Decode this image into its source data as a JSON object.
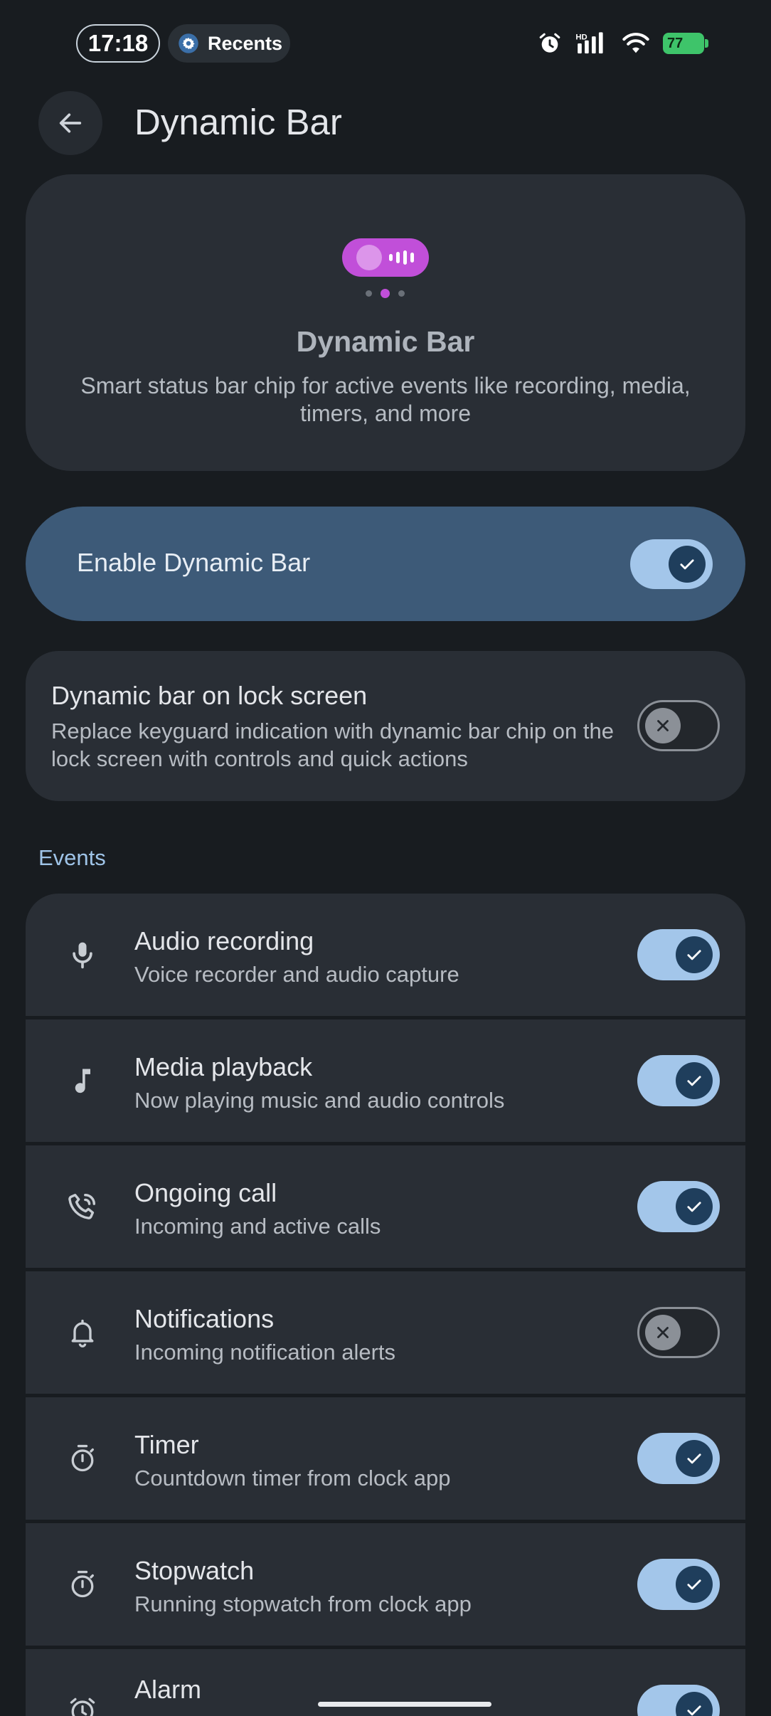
{
  "status_bar": {
    "time": "17:18",
    "recents_label": "Recents",
    "battery": "77",
    "icons": [
      "gear-icon",
      "alarm-icon",
      "signal-hd-icon",
      "wifi-icon",
      "battery-charging-icon"
    ]
  },
  "app_bar": {
    "title": "Dynamic Bar",
    "back_icon": "arrow-back-icon"
  },
  "hero": {
    "title": "Dynamic Bar",
    "description": "Smart status bar chip for active events like recording, media, timers, and more",
    "chip_color": "#c14fd9",
    "pager_active_index": 1,
    "pager_count": 3
  },
  "enable": {
    "label": "Enable Dynamic Bar",
    "checked": true
  },
  "lockscreen": {
    "title": "Dynamic bar on lock screen",
    "description": "Replace keyguard indication with dynamic bar chip on the lock screen with controls and quick actions",
    "checked": false
  },
  "events_section": {
    "header": "Events",
    "items": [
      {
        "title": "Audio recording",
        "subtitle": "Voice recorder and audio capture",
        "icon": "microphone-icon",
        "checked": true
      },
      {
        "title": "Media playback",
        "subtitle": "Now playing music and audio controls",
        "icon": "music-note-icon",
        "checked": true
      },
      {
        "title": "Ongoing call",
        "subtitle": "Incoming and active calls",
        "icon": "phone-call-icon",
        "checked": true
      },
      {
        "title": "Notifications",
        "subtitle": "Incoming notification alerts",
        "icon": "bell-icon",
        "checked": false
      },
      {
        "title": "Timer",
        "subtitle": "Countdown timer from clock app",
        "icon": "timer-icon",
        "checked": true
      },
      {
        "title": "Stopwatch",
        "subtitle": "Running stopwatch from clock app",
        "icon": "stopwatch-icon",
        "checked": true
      },
      {
        "title": "Alarm",
        "subtitle": "",
        "icon": "alarm-clock-icon",
        "checked": true
      }
    ]
  },
  "colors": {
    "background": "#181c20",
    "card": "#292e35",
    "enable_card": "#3d5a78",
    "switch_on_track": "#a3c6ea",
    "switch_on_thumb": "#1f3e5c",
    "accent_text": "#9fc4e8"
  }
}
